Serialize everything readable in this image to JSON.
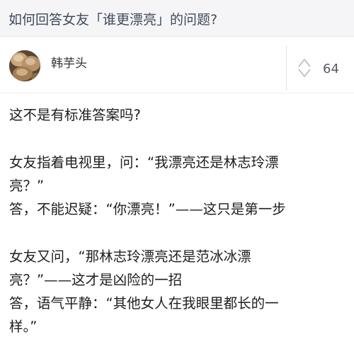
{
  "question": {
    "title": "如何回答女友「谁更漂亮」的问题?"
  },
  "answer": {
    "author": "韩芋头",
    "vote_count": "64",
    "avatar_icon": "food-photo-avatar",
    "vote_icon": "vote-arrows-icon",
    "paragraphs": [
      [
        "这不是有标准答案吗?"
      ],
      [
        "女友指着电视里，问：“我漂亮还是林志玲漂",
        "亮？”",
        "答，不能迟疑：“你漂亮！”——这只是第一步"
      ],
      [
        "女友又问，“那林志玲漂亮还是范冰冰漂",
        "亮？”——这才是凶险的一招",
        "答，语气平静：“其他女人在我眼里都长的一",
        "样。”"
      ]
    ]
  },
  "colors": {
    "question_bar_bg": "#f5f5f7",
    "question_text": "#404a5a",
    "body_text": "#1e1e1e",
    "vote_text": "#555a63"
  }
}
